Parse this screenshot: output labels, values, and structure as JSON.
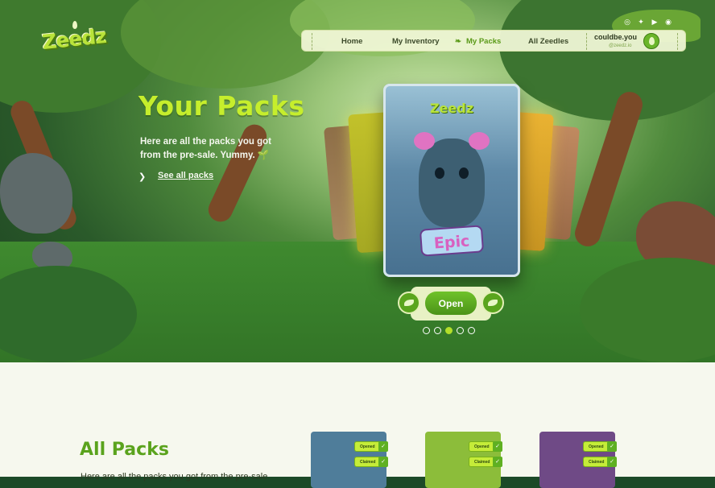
{
  "brand": {
    "logo_text": "Zeedz"
  },
  "social": [
    {
      "icon": "instagram-icon",
      "glyph": "◎"
    },
    {
      "icon": "twitter-icon",
      "glyph": "✦"
    },
    {
      "icon": "youtube-icon",
      "glyph": "▶"
    },
    {
      "icon": "discord-icon",
      "glyph": "◉"
    }
  ],
  "nav": {
    "items": [
      {
        "label": "Home",
        "active": false
      },
      {
        "label": "My Inventory",
        "active": false
      },
      {
        "label": "My Packs",
        "active": true
      },
      {
        "label": "All Zeedles",
        "active": false
      }
    ],
    "user": {
      "name": "couldbe.you",
      "handle": "@zeedz.io"
    }
  },
  "hero": {
    "title": "Your Packs",
    "description": "Here are all the packs you got from the pre-sale. Yummy. 🌱",
    "see_all": "See all packs",
    "featured_pack": {
      "logo": "Zeedz",
      "rarity": "Epic"
    },
    "open_label": "Open",
    "carousel": {
      "count": 5,
      "active_index": 2
    }
  },
  "all_packs": {
    "title": "All Packs",
    "description": "Here are all the packs you got from the pre-sale.",
    "cards": [
      {
        "color": "#4f7d9a",
        "chips": [
          "Opened",
          "Claimed"
        ]
      },
      {
        "color": "#8cbd3a",
        "chips": [
          "Opened",
          "Claimed"
        ]
      },
      {
        "color": "#6f4a86",
        "chips": [
          "Opened",
          "Claimed"
        ]
      }
    ]
  },
  "colors": {
    "accent": "#b3df2a",
    "brand_green": "#5aa31d",
    "nav_bg": "#f0f6d6"
  }
}
